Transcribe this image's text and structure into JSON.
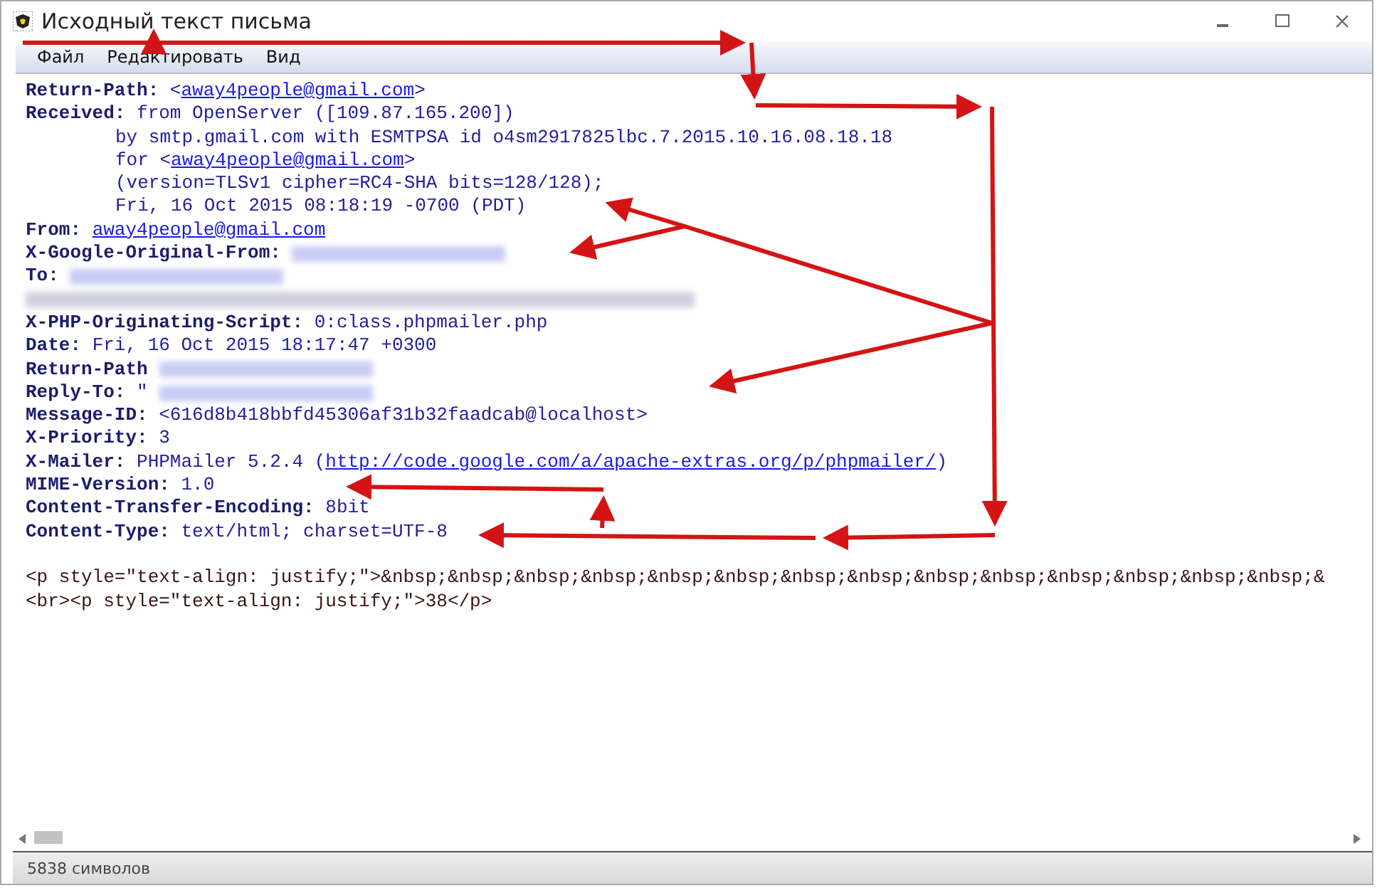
{
  "window": {
    "title": "Исходный текст письма"
  },
  "menu": [
    "Файл",
    "Редактировать",
    "Вид"
  ],
  "lines": [
    {
      "kind": "header",
      "parts": [
        {
          "kind": "key",
          "text": "Return-Path:"
        },
        {
          "kind": "value",
          "text": " <"
        },
        {
          "kind": "link",
          "text": "away4people@gmail.com"
        },
        {
          "kind": "value",
          "text": ">"
        }
      ]
    },
    {
      "kind": "header",
      "parts": [
        {
          "kind": "key",
          "text": "Received:"
        },
        {
          "kind": "value",
          "text": " from OpenServer ([109.87.165.200])"
        }
      ]
    },
    {
      "kind": "continuation",
      "parts": [
        {
          "kind": "value",
          "text": "by smtp.gmail.com with ESMTPSA id o4sm2917825lbc.7.2015.10.16.08.18.18"
        }
      ]
    },
    {
      "kind": "continuation",
      "parts": [
        {
          "kind": "value",
          "text": "for <"
        },
        {
          "kind": "link",
          "text": "away4people@gmail.com"
        },
        {
          "kind": "value",
          "text": ">"
        }
      ]
    },
    {
      "kind": "continuation",
      "parts": [
        {
          "kind": "value",
          "text": "(version=TLSv1 cipher=RC4-SHA bits=128/128);"
        }
      ]
    },
    {
      "kind": "continuation",
      "parts": [
        {
          "kind": "value",
          "text": "Fri, 16 Oct 2015 08:18:19 -0700 (PDT)"
        }
      ]
    },
    {
      "kind": "header",
      "parts": [
        {
          "kind": "key",
          "text": "From:"
        },
        {
          "kind": "link",
          "text": "away4people@gmail.com"
        }
      ]
    },
    {
      "kind": "header",
      "parts": [
        {
          "kind": "key",
          "text": "X-Google-Original-From:"
        },
        {
          "kind": "redacted"
        }
      ]
    },
    {
      "kind": "header",
      "parts": [
        {
          "kind": "key",
          "text": "To:"
        },
        {
          "kind": "redacted"
        }
      ]
    },
    {
      "kind": "header",
      "parts": [
        {
          "kind": "redacted_line"
        }
      ]
    },
    {
      "kind": "header",
      "parts": [
        {
          "kind": "key",
          "text": "X-PHP-Originating-Script:"
        },
        {
          "kind": "value",
          "text": " 0:class.phpmailer.php"
        }
      ]
    },
    {
      "kind": "header",
      "parts": [
        {
          "kind": "key",
          "text": "Date:"
        },
        {
          "kind": "value",
          "text": " Fri, 16 Oct 2015 18:17:47 +0300"
        }
      ]
    },
    {
      "kind": "header",
      "parts": [
        {
          "kind": "key",
          "text": "Return-Path"
        },
        {
          "kind": "redacted"
        }
      ]
    },
    {
      "kind": "header",
      "parts": [
        {
          "kind": "key",
          "text": "Reply-To:"
        },
        {
          "kind": "value",
          "text": " \""
        },
        {
          "kind": "redacted"
        }
      ]
    },
    {
      "kind": "header",
      "parts": [
        {
          "kind": "key",
          "text": "Message-ID:"
        },
        {
          "kind": "value",
          "text": " <616d8b418bbfd45306af31b32faadcab@localhost>"
        }
      ]
    },
    {
      "kind": "header",
      "parts": [
        {
          "kind": "key",
          "text": "X-Priority:"
        },
        {
          "kind": "value",
          "text": " 3"
        }
      ]
    },
    {
      "kind": "header",
      "parts": [
        {
          "kind": "key",
          "text": "X-Mailer:"
        },
        {
          "kind": "value",
          "text": " PHPMailer 5.2.4 ("
        },
        {
          "kind": "link",
          "text": "http://code.google.com/a/apache-extras.org/p/phpmailer/"
        },
        {
          "kind": "value",
          "text": ")"
        }
      ]
    },
    {
      "kind": "header",
      "parts": [
        {
          "kind": "key",
          "text": "MIME-Version:"
        },
        {
          "kind": "value",
          "text": " 1.0"
        }
      ]
    },
    {
      "kind": "header",
      "parts": [
        {
          "kind": "key",
          "text": "Content-Transfer-Encoding:"
        },
        {
          "kind": "value",
          "text": " 8bit"
        }
      ]
    },
    {
      "kind": "header",
      "parts": [
        {
          "kind": "key",
          "text": "Content-Type:"
        },
        {
          "kind": "value",
          "text": " text/html; charset=UTF-8"
        }
      ]
    },
    {
      "kind": "blank"
    },
    {
      "kind": "body",
      "parts": [
        {
          "kind": "body",
          "text": "<p style=\"text-align: justify;\">&nbsp;&nbsp;&nbsp;&nbsp;&nbsp;&nbsp;&nbsp;&nbsp;&nbsp;&nbsp;&nbsp;&nbsp;&nbsp;&nbsp;&"
        }
      ]
    },
    {
      "kind": "body",
      "parts": [
        {
          "kind": "body",
          "text": "<br><p style=\"text-align: justify;\">38</p>"
        }
      ]
    }
  ],
  "status_bar": {
    "text": "5838 символов"
  }
}
